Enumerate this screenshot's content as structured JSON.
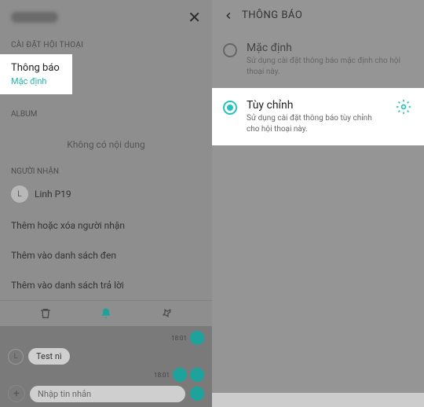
{
  "left": {
    "close_label": "✕",
    "section_chat_settings": "CÀI ĐẶT HỘI THOẠI",
    "notif_title": "Thông báo",
    "notif_value": "Mặc định",
    "album_label": "ALBUM",
    "album_empty": "Không có nội dung",
    "recipients_label": "NGƯỜI NHẬN",
    "recipient_initial": "L",
    "recipient_name": "Linh P19",
    "actions": {
      "add_remove": "Thêm hoặc xóa người nhận",
      "blacklist": "Thêm vào danh sách đen",
      "replylist": "Thêm vào danh sách trả lời"
    },
    "msg_time": "18:01",
    "msg_text": "Test nì",
    "input_placeholder": "Nhập tin nhắn"
  },
  "right": {
    "header_title": "THÔNG BÁO",
    "option_default": {
      "title": "Mặc định",
      "desc": "Sử dụng cài đặt thông báo mặc định cho hội thoại này."
    },
    "option_custom": {
      "title": "Tùy chỉnh",
      "desc": "Sử dụng cài đặt thông báo tùy chỉnh cho hội thoại này."
    }
  }
}
